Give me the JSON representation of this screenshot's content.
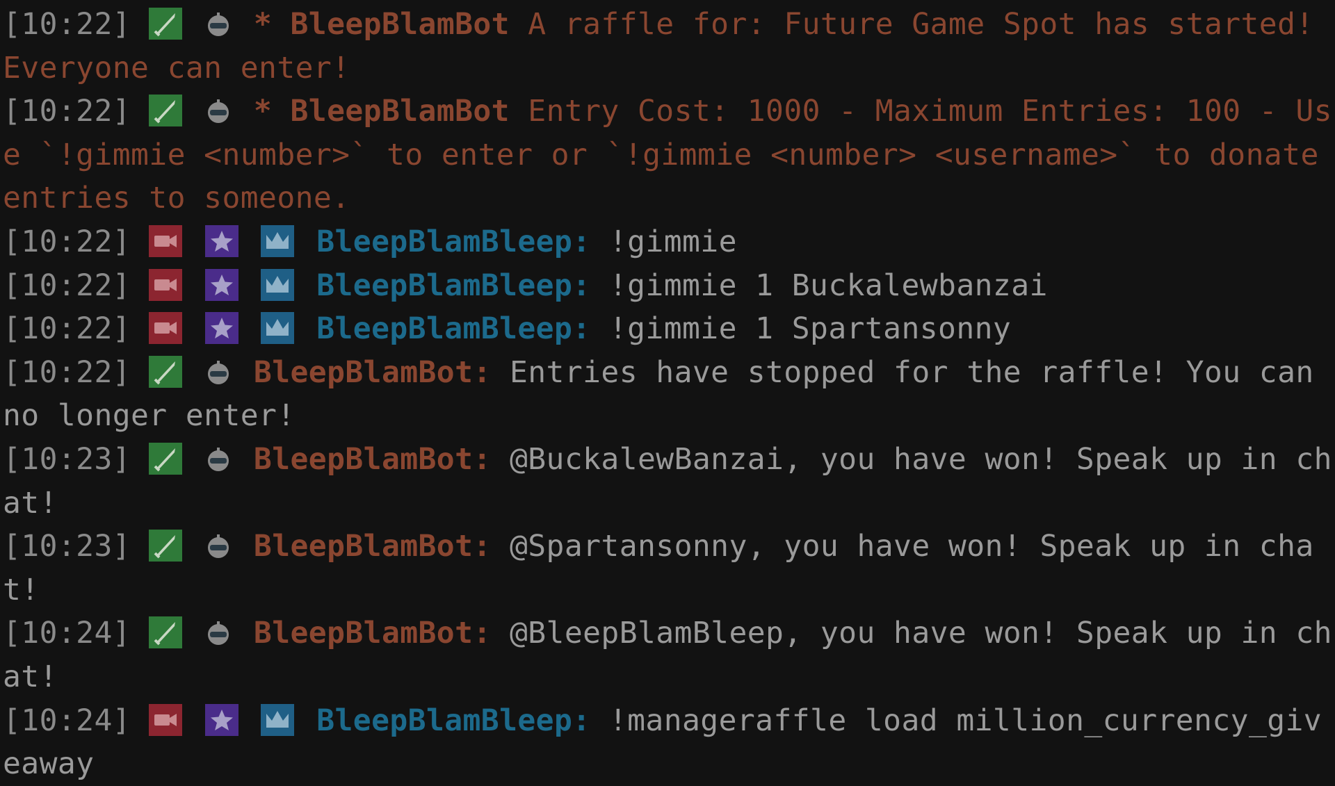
{
  "colors": {
    "background": "#121212",
    "timestamp": "#8a8a8a",
    "message_text": "#9a9a9a",
    "bot_name": "#8a4630",
    "bot_action_text": "#8a4630",
    "user_name": "#1c6a8c",
    "mod_badge": "#2f7a39",
    "broadcaster_badge": "#8c2530",
    "vip_badge": "#4a2c8a",
    "sub_badge": "#1f5f86"
  },
  "messages": [
    {
      "time": "[10:22]",
      "sender": "BleepBlamBot",
      "sender_suffix": "",
      "action_prefix": "*",
      "text": "A raffle for: Future Game Spot has started! Everyone can enter!",
      "badges": [
        "sword-icon",
        "robot-icon"
      ]
    },
    {
      "time": "[10:22]",
      "sender": "BleepBlamBot",
      "sender_suffix": "",
      "action_prefix": "*",
      "text": "Entry Cost: 1000 - Maximum Entries: 100 - Use `!gimmie <number>` to enter or `!gimmie <number> <username>` to donate entries to someone.",
      "badges": [
        "sword-icon",
        "robot-icon"
      ]
    },
    {
      "time": "[10:22]",
      "sender": "BleepBlamBleep",
      "sender_suffix": ":",
      "text": "!gimmie",
      "badges": [
        "camera-icon",
        "star-icon",
        "crown-icon"
      ]
    },
    {
      "time": "[10:22]",
      "sender": "BleepBlamBleep",
      "sender_suffix": ":",
      "text": "!gimmie 1 Buckalewbanzai",
      "badges": [
        "camera-icon",
        "star-icon",
        "crown-icon"
      ]
    },
    {
      "time": "[10:22]",
      "sender": "BleepBlamBleep",
      "sender_suffix": ":",
      "text": "!gimmie 1 Spartansonny",
      "badges": [
        "camera-icon",
        "star-icon",
        "crown-icon"
      ]
    },
    {
      "time": "[10:22]",
      "sender": "BleepBlamBot",
      "sender_suffix": ":",
      "text": "Entries have stopped for the raffle! You can no longer enter!",
      "badges": [
        "sword-icon",
        "robot-icon"
      ]
    },
    {
      "time": "[10:23]",
      "sender": "BleepBlamBot",
      "sender_suffix": ":",
      "text": "@BuckalewBanzai, you have won! Speak up in chat!",
      "badges": [
        "sword-icon",
        "robot-icon"
      ]
    },
    {
      "time": "[10:23]",
      "sender": "BleepBlamBot",
      "sender_suffix": ":",
      "text": "@Spartansonny, you have won! Speak up in chat!",
      "badges": [
        "sword-icon",
        "robot-icon"
      ]
    },
    {
      "time": "[10:24]",
      "sender": "BleepBlamBot",
      "sender_suffix": ":",
      "text": "@BleepBlamBleep, you have won! Speak up in chat!",
      "badges": [
        "sword-icon",
        "robot-icon"
      ]
    },
    {
      "time": "[10:24]",
      "sender": "BleepBlamBleep",
      "sender_suffix": ":",
      "text": "!manageraffle load million_currency_giveaway",
      "badges": [
        "camera-icon",
        "star-icon",
        "crown-icon"
      ]
    }
  ]
}
